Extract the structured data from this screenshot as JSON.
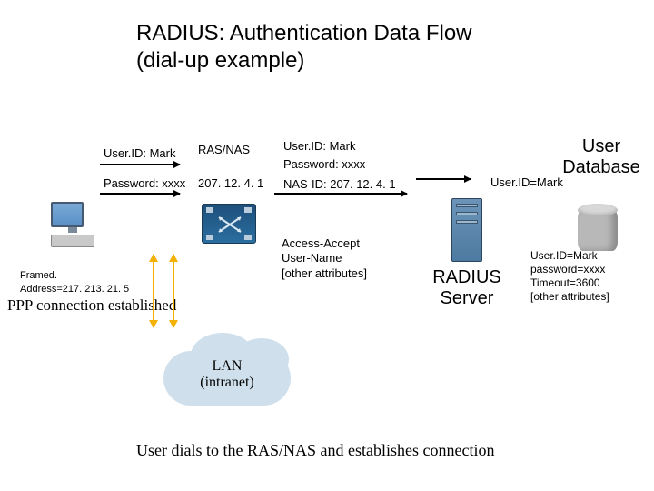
{
  "title_line1": "RADIUS: Authentication Data Flow",
  "title_line2": "(dial-up example)",
  "client": {
    "userid": "User.ID: Mark",
    "password": "Password: xxxx"
  },
  "nas": {
    "label": "RAS/NAS",
    "ip": "207. 12. 4. 1"
  },
  "access_request": {
    "userid": "User.ID: Mark",
    "password": "Password: xxxx",
    "nasid": "NAS-ID: 207. 12. 4. 1"
  },
  "access_accept": {
    "l1": "Access-Accept",
    "l2": "User-Name",
    "l3": "[other attributes]"
  },
  "radius_label_l1": "RADIUS",
  "radius_label_l2": "Server",
  "db_label_l1": "User",
  "db_label_l2": "Database",
  "db_query": "User.ID=Mark",
  "db_result": {
    "l1": "User.ID=Mark",
    "l2": "password=xxxx",
    "l3": "Timeout=3600",
    "l4": "[other attributes]"
  },
  "framed_l1": "Framed.",
  "framed_l2": "Address=217. 213. 21. 5",
  "ppp_text": "PPP connection established",
  "cloud_l1": "LAN",
  "cloud_l2": "(intranet)",
  "caption": "User dials to the  RAS/NAS and establishes connection"
}
